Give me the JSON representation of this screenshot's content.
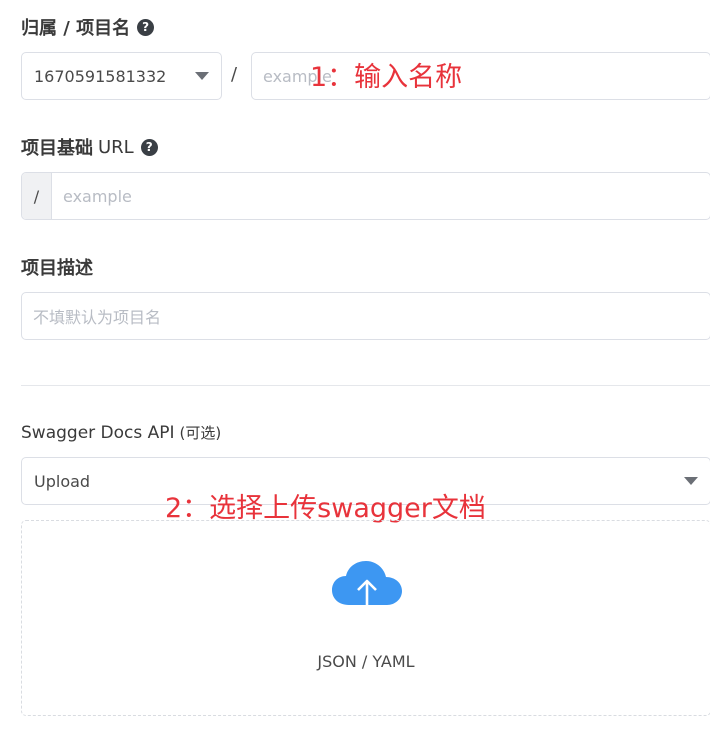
{
  "owner_project": {
    "label": "归属 / 项目名",
    "owner_value": "1670591581332",
    "separator": "/",
    "name_placeholder": "example"
  },
  "base_url": {
    "label_main": "项目基础",
    "label_suffix": "URL",
    "prefix": "/",
    "placeholder": "example"
  },
  "description": {
    "label": "项目描述",
    "placeholder": "不填默认为项目名"
  },
  "swagger": {
    "label": "Swagger Docs API",
    "optional": "(可选)",
    "select_value": "Upload",
    "upload_caption": "JSON / YAML"
  },
  "annotations": {
    "step1": "1：输入名称",
    "step2": "2：选择上传swagger文档"
  },
  "icons": {
    "help": "question-circle-icon",
    "dropdown": "caret-down-icon",
    "upload": "cloud-upload-icon"
  },
  "colors": {
    "annotation": "#e8333b",
    "upload_icon": "#3d97f2"
  }
}
